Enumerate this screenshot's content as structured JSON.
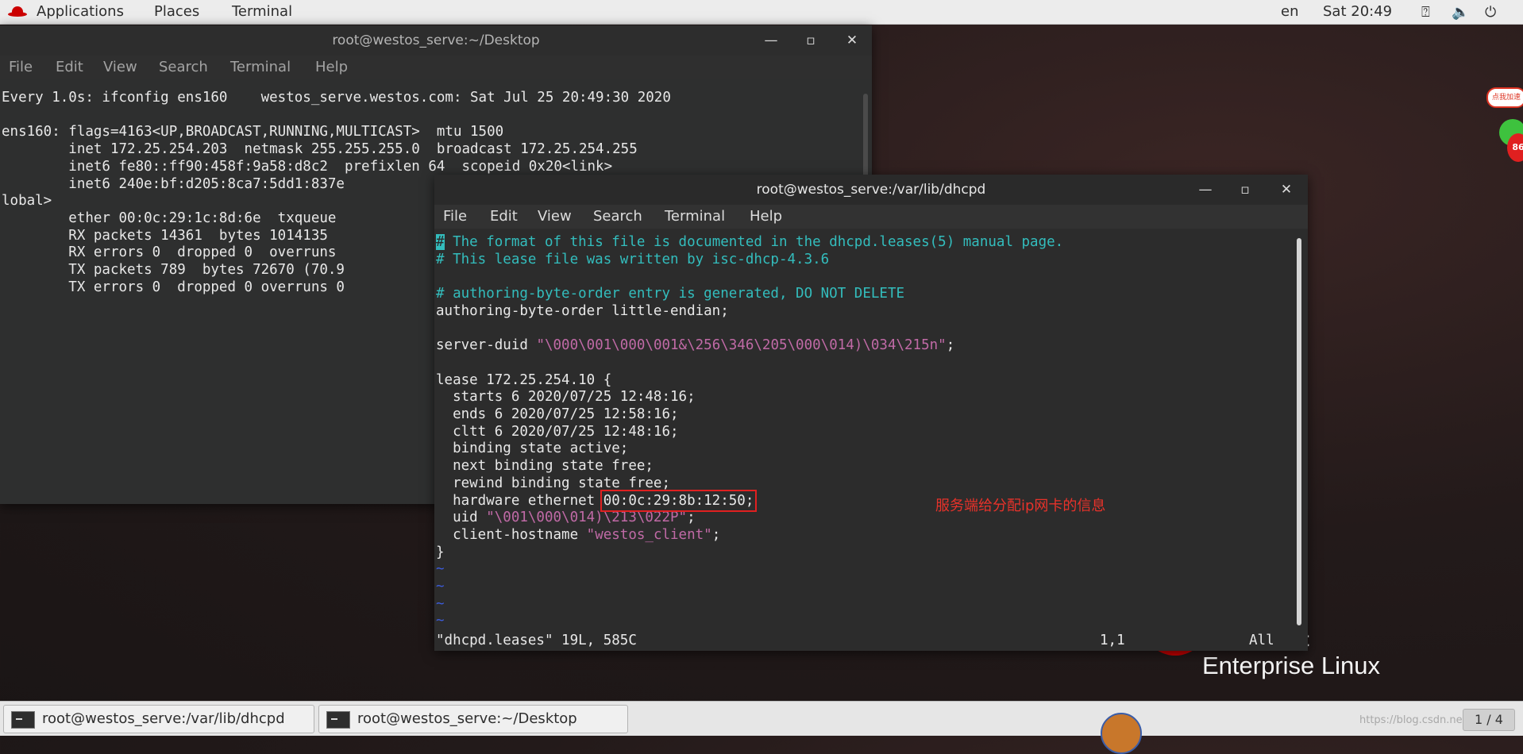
{
  "topbar": {
    "applications": "Applications",
    "places": "Places",
    "terminal": "Terminal",
    "lang": "en",
    "clock": "Sat 20:49",
    "icons": [
      "accessibility-icon",
      "volume-icon",
      "power-icon"
    ]
  },
  "desktop": {
    "logo_text": "Enterprise Linux",
    "logo_partial": "t",
    "widget_text": "点我加速",
    "widget_badge": "86"
  },
  "back_window": {
    "title": "root@westos_serve:~/Desktop",
    "menu": [
      "File",
      "Edit",
      "View",
      "Search",
      "Terminal",
      "Help"
    ],
    "lines": [
      "Every 1.0s: ifconfig ens160    westos_serve.westos.com: Sat Jul 25 20:49:30 2020",
      "",
      "ens160: flags=4163<UP,BROADCAST,RUNNING,MULTICAST>  mtu 1500",
      "        inet 172.25.254.203  netmask 255.255.255.0  broadcast 172.25.254.255",
      "        inet6 fe80::ff90:458f:9a58:d8c2  prefixlen 64  scopeid 0x20<link>",
      "        inet6 240e:bf:d205:8ca7:5dd1:837e",
      "lobal>",
      "        ether 00:0c:29:1c:8d:6e  txqueue",
      "        RX packets 14361  bytes 1014135",
      "        RX errors 0  dropped 0  overruns",
      "        TX packets 789  bytes 72670 (70.9",
      "        TX errors 0  dropped 0 overruns 0"
    ]
  },
  "front_window": {
    "title": "root@westos_serve:/var/lib/dhcpd",
    "menu": [
      "File",
      "Edit",
      "View",
      "Search",
      "Terminal",
      "Help"
    ],
    "file": {
      "comment1_rest": " The format of this file is documented in the dhcpd.leases(5) manual page.",
      "comment2": "# This lease file was written by isc-dhcp-4.3.6",
      "comment3": "# authoring-byte-order entry is generated, DO NOT DELETE",
      "abo": "authoring-byte-order little-endian;",
      "duid_key": "server-duid ",
      "duid_val": "\"\\000\\001\\000\\001&\\256\\346\\205\\000\\014)\\034\\215n\"",
      "lease_open": "lease 172.25.254.10 {",
      "starts": "  starts 6 2020/07/25 12:48:16;",
      "ends": "  ends 6 2020/07/25 12:58:16;",
      "cltt": "  cltt 6 2020/07/25 12:48:16;",
      "bind": "  binding state active;",
      "next": "  next binding state free;",
      "rewind": "  rewind binding state free;",
      "hw_key": "  hardware ethernet ",
      "hw_val": "00:0c:29:8b:12:50;",
      "uid_key": "  uid ",
      "uid_val": "\"\\001\\000\\014)\\213\\022P\"",
      "host_key": "  client-hostname ",
      "host_val": "\"westos_client\"",
      "close": "}",
      "tilde": "~"
    },
    "status": {
      "file": "\"dhcpd.leases\" 19L, 585C",
      "pos": "1,1",
      "all": "All"
    }
  },
  "annotation": "服务端给分配ip网卡的信息",
  "taskbar": {
    "tasks": [
      "root@westos_serve:/var/lib/dhcpd",
      "root@westos_serve:~/Desktop"
    ],
    "workspace": "1 / 4",
    "watermark": "https://blog.csdn.net/...t/5"
  },
  "colors": {
    "comment": "#33bdbd",
    "string": "#c06aa6",
    "tilde": "#3c5cdc",
    "annotation": "#e8322a"
  }
}
